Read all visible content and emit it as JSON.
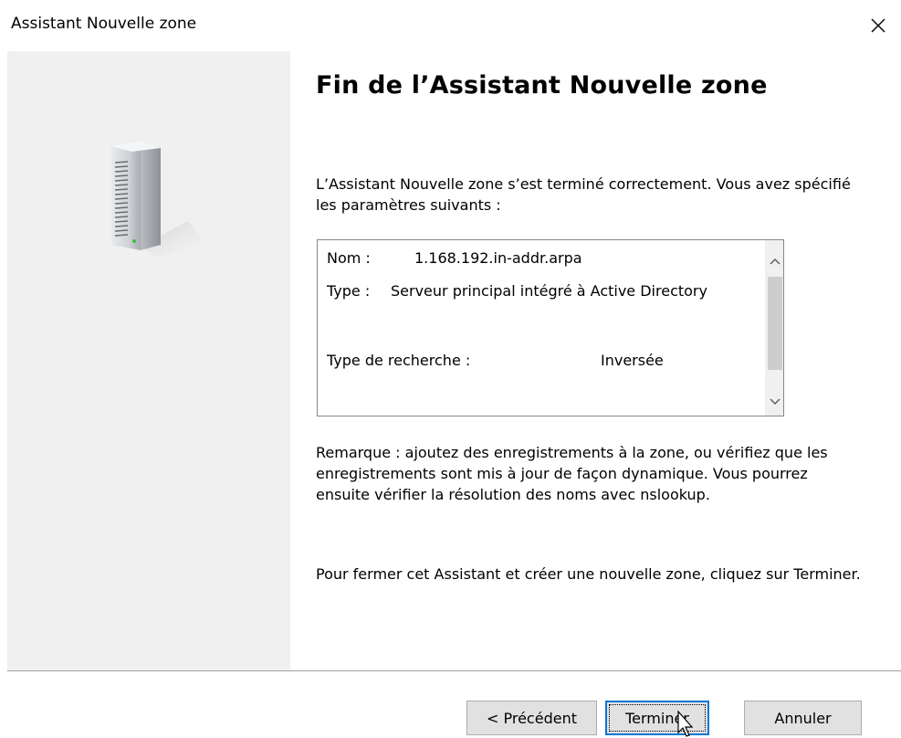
{
  "window": {
    "title": "Assistant Nouvelle zone",
    "close_icon": "close-icon"
  },
  "banner": {
    "icon": "server-icon"
  },
  "content": {
    "heading": "Fin de l’Assistant Nouvelle zone",
    "intro": "L’Assistant Nouvelle zone s’est terminé correctement. Vous avez spécifié les paramètres suivants :",
    "summary": {
      "nom_label": "Nom :",
      "nom_value": "1.168.192.in-addr.arpa",
      "type_label": "Type :",
      "type_value": "Serveur principal intégré à Active Directory",
      "recherche_label": "Type de recherche :",
      "recherche_value": "Inversée"
    },
    "note": "Remarque : ajoutez des enregistrements à la zone, ou vérifiez que les enregistrements sont mis à jour de façon dynamique. Vous pourrez ensuite vérifier la résolution des noms avec nslookup.",
    "close_note": "Pour fermer cet Assistant et créer une nouvelle zone, cliquez sur Terminer."
  },
  "buttons": {
    "previous": "< Précédent",
    "finish": "Terminer",
    "cancel": "Annuler"
  },
  "colors": {
    "banner": "#f0f0f0",
    "button_face": "#e1e1e1",
    "default_button_border": "#0078d7"
  }
}
